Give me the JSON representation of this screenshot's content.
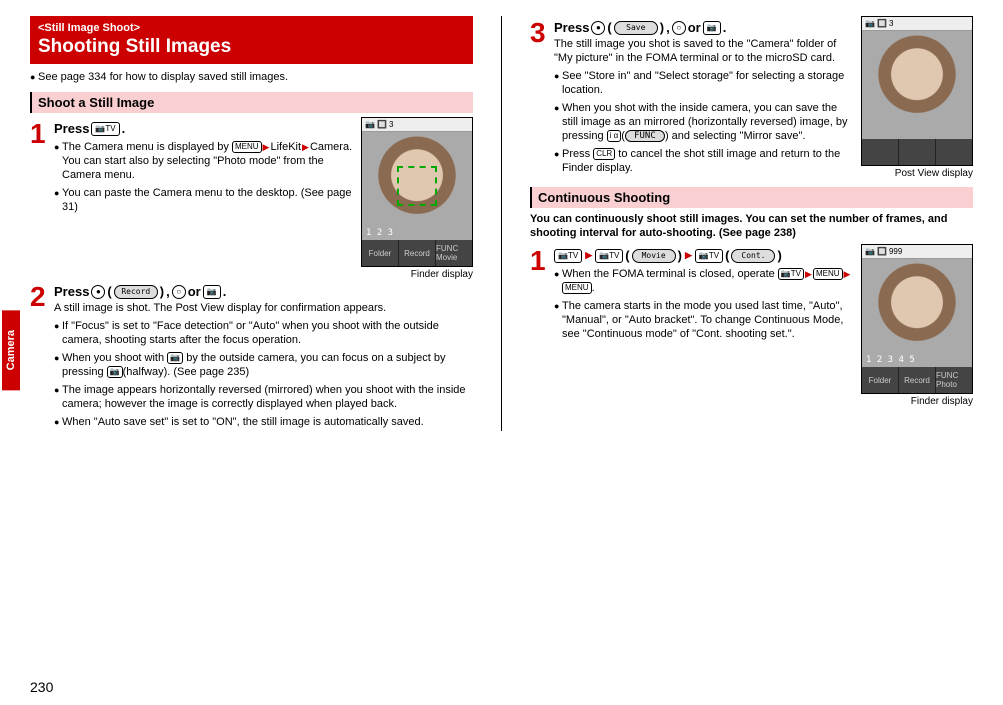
{
  "sidetab": "Camera",
  "pagenum": "230",
  "left": {
    "header_tag": "<Still Image Shoot>",
    "header_title": "Shooting Still Images",
    "intro_bullet": "See page 334 for how to display saved still images.",
    "section1": "Shoot a Still Image",
    "step1": {
      "num": "1",
      "title_a": "Press ",
      "title_key": "📷TV",
      "title_b": ".",
      "b1": "The Camera menu is displayed by ",
      "b1_key": "MENU",
      "b1_c": "LifeKit",
      "b1_d": "Camera. You can start also by selecting \"Photo mode\" from the Camera menu.",
      "b2": "You can paste the Camera menu to the desktop. (See page 31)"
    },
    "img1_cap": "Finder display",
    "img1_nums": "1 2 3",
    "img1_foot1": "Folder",
    "img1_foot2": "Record",
    "img1_foot3": "FUNC Movie",
    "step2": {
      "num": "2",
      "title_a": "Press ",
      "title_key1": "●",
      "title_pill1": "Record",
      "title_b": ", ",
      "title_key2": "○",
      "title_c": " or ",
      "title_key3": "📷",
      "title_d": ".",
      "line1": "A still image is shot. The Post View display for confirmation appears.",
      "b1": "If \"Focus\" is set to \"Face detection\" or \"Auto\" when you shoot with the outside camera, shooting starts after the focus operation.",
      "b2_a": "When you shoot with ",
      "b2_key": "📷",
      "b2_b": " by the outside camera, you can focus on a subject by pressing ",
      "b2_key2": "📷",
      "b2_c": "(halfway). (See page 235)",
      "b3": "The image appears horizontally reversed (mirrored) when you shoot with the inside camera; however the image is correctly displayed when played back.",
      "b4": "When \"Auto save set\" is set to \"ON\", the still image is automatically saved."
    }
  },
  "right": {
    "step3": {
      "num": "3",
      "title_a": "Press ",
      "title_key1": "●",
      "title_pill1": "Save",
      "title_b": ", ",
      "title_key2": "○",
      "title_c": " or ",
      "title_key3": "📷",
      "title_d": ".",
      "line1": "The still image you shot is saved to the \"Camera\" folder of \"My picture\" in the FOMA terminal or to the microSD card.",
      "b1": "See \"Store in\" and \"Select storage\" for selecting a storage location.",
      "b2_a": "When you shot with the inside camera, you can save the still image as an mirrored (horizontally reversed) image, by pressing ",
      "b2_key": "i α",
      "b2_pill": "FUNC",
      "b2_b": " and selecting \"Mirror save\".",
      "b3_a": "Press ",
      "b3_key": "CLR",
      "b3_b": " to cancel the shot still image and return to the Finder display."
    },
    "img2_cap": "Post View display",
    "img2_foot1": "",
    "img2_foot2": "",
    "img2_foot3": "",
    "section2": "Continuous Shooting",
    "intro2": "You can continuously shoot still images. You can set the number of frames, and shooting interval for auto-shooting. (See page 238)",
    "step1b": {
      "num": "1",
      "title_key1": "📷TV",
      "title_key2": "📷TV",
      "title_pill1": "Movie",
      "title_key3": "📷TV",
      "title_pill2": "Cont.",
      "b1_a": "When the FOMA terminal is closed, operate ",
      "b1_k1": "📷TV",
      "b1_k2": "MENU",
      "b1_k3": "MENU",
      "b1_b": ".",
      "b2": "The camera starts in the mode you used last time, \"Auto\", \"Manual\", or \"Auto bracket\". To change Continuous Mode, see \"Continuous mode\" of \"Cont. shooting set.\"."
    },
    "img3_cap": "Finder display",
    "img3_nums": "1 2 3 4 5",
    "img3_foot1": "Folder",
    "img3_foot2": "Record",
    "img3_foot3": "FUNC Photo",
    "img3_tophex": "999"
  }
}
